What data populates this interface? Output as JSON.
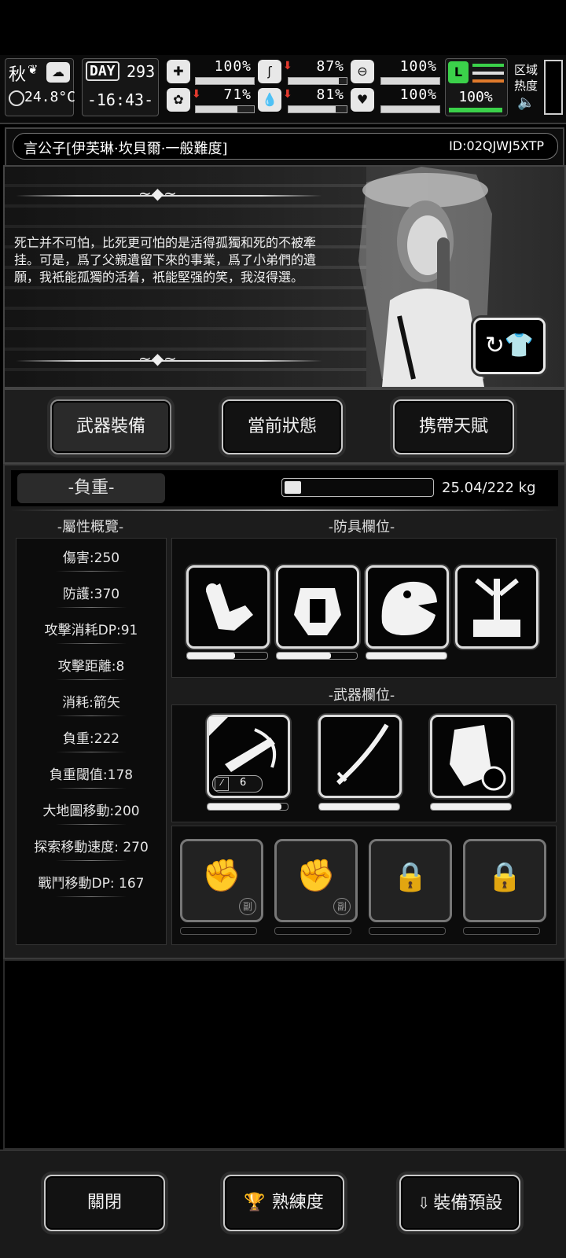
{
  "hud": {
    "season": "秋",
    "temperature": "24.8°C",
    "day_label": "DAY",
    "day": "293",
    "time": "-16:43-",
    "stats": [
      {
        "name": "health",
        "icon": "medkit-icon",
        "value": "100%",
        "level": 1.0,
        "dropping": false
      },
      {
        "name": "hunger",
        "icon": "stomach-icon",
        "value": "87%",
        "level": 0.87,
        "dropping": true
      },
      {
        "name": "stamina",
        "icon": "pill-icon",
        "value": "100%",
        "level": 1.0,
        "dropping": false
      },
      {
        "name": "sanity",
        "icon": "brain-icon",
        "value": "71%",
        "level": 0.71,
        "dropping": true
      },
      {
        "name": "thirst",
        "icon": "water-drop-icon",
        "value": "81%",
        "level": 0.81,
        "dropping": true
      },
      {
        "name": "mood",
        "icon": "heart-icon",
        "value": "100%",
        "level": 1.0,
        "dropping": false
      }
    ],
    "leg_value": "100%",
    "zone_label_1": "区域",
    "zone_label_2": "热度"
  },
  "character": {
    "title": "言公子[伊芙琳·坎貝爾·一般難度]",
    "id": "ID:02QJWJ5XTP",
    "quote": "死亡并不可怕，比死更可怕的是活得孤獨和死的不被牽挂。可是，爲了父親遺留下來的事業，爲了小弟們的遺願，我衹能孤獨的活着，衹能堅强的笑，我沒得選。"
  },
  "tabs": [
    {
      "label": "武器裝備",
      "selected": true
    },
    {
      "label": "當前狀態",
      "selected": false
    },
    {
      "label": "携帶天賦",
      "selected": false
    }
  ],
  "weight": {
    "label": "-負重-",
    "text": "25.04/222 kg",
    "fraction": 0.113
  },
  "attributes": {
    "title": "-屬性概覽-",
    "items": [
      "傷害:250",
      "防護:370",
      "攻擊消耗DP:91",
      "攻擊距離:8",
      "消耗:箭矢",
      "負重:222",
      "負重閾值:178",
      "大地圖移動:200",
      "探索移動速度: 270",
      "戰鬥移動DP: 167"
    ]
  },
  "armor": {
    "title": "-防具欄位-",
    "slots": [
      {
        "icon": "armored-arm-icon",
        "durability": 0.6
      },
      {
        "icon": "chest-armor-icon",
        "durability": 0.68
      },
      {
        "icon": "dinosaur-head-icon",
        "durability": 1.0
      },
      {
        "icon": "backpack-frame-icon",
        "durability": 0
      }
    ]
  },
  "weapons": {
    "title": "-武器欄位-",
    "ammo": "6",
    "slots": [
      {
        "icon": "crossbow-icon",
        "durability": 0.92
      },
      {
        "icon": "katana-icon",
        "durability": 1.0
      },
      {
        "icon": "riot-shield-icon",
        "durability": 1.0
      }
    ],
    "sub_slots": [
      {
        "icon": "fist-icon",
        "badge": "副",
        "locked": false
      },
      {
        "icon": "fist-icon",
        "badge": "副",
        "locked": false
      },
      {
        "icon": "padlock-icon",
        "badge": "",
        "locked": true
      },
      {
        "icon": "padlock-icon",
        "badge": "",
        "locked": true
      }
    ]
  },
  "bottom": {
    "close": "關閉",
    "proficiency": "熟練度",
    "preset": "裝備預設"
  }
}
